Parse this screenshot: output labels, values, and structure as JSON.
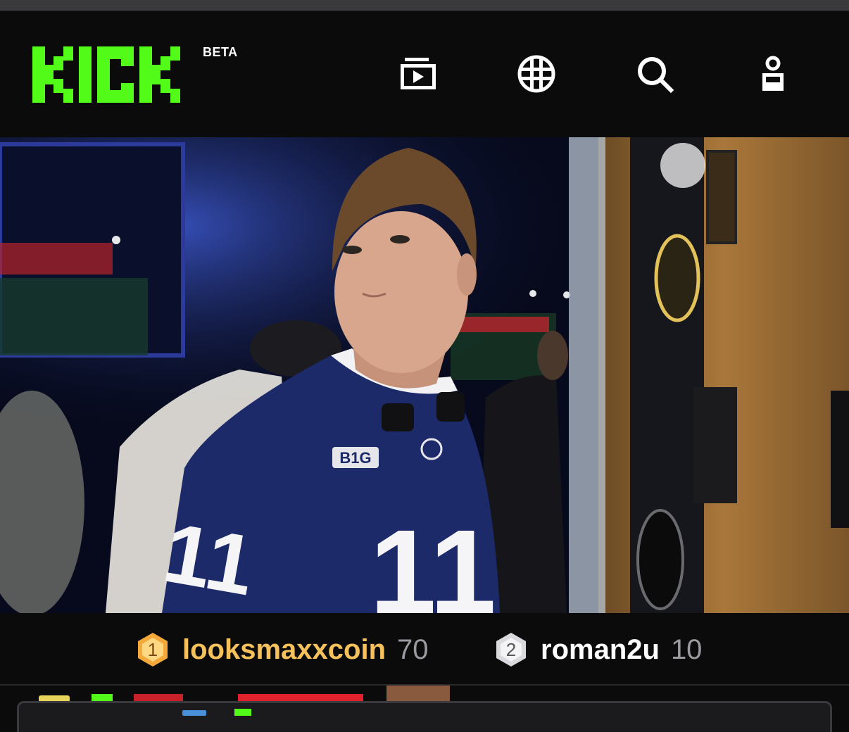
{
  "app": {
    "brand": "KICK",
    "badge": "BETA",
    "brand_color": "#53fc18"
  },
  "nav": {
    "icons": [
      "following-icon",
      "browse-icon",
      "search-icon",
      "profile-icon"
    ]
  },
  "video": {
    "jersey_number": "11",
    "jersey_logo": "B1G"
  },
  "leaderboard": {
    "entries": [
      {
        "rank": "1",
        "name": "looksmaxxcoin",
        "score": "70",
        "name_color": "#f6c15a",
        "badge_color": "#f4a93a"
      },
      {
        "rank": "2",
        "name": "roman2u",
        "score": "10",
        "name_color": "#ffffff",
        "badge_color": "#d9d9de"
      }
    ]
  }
}
